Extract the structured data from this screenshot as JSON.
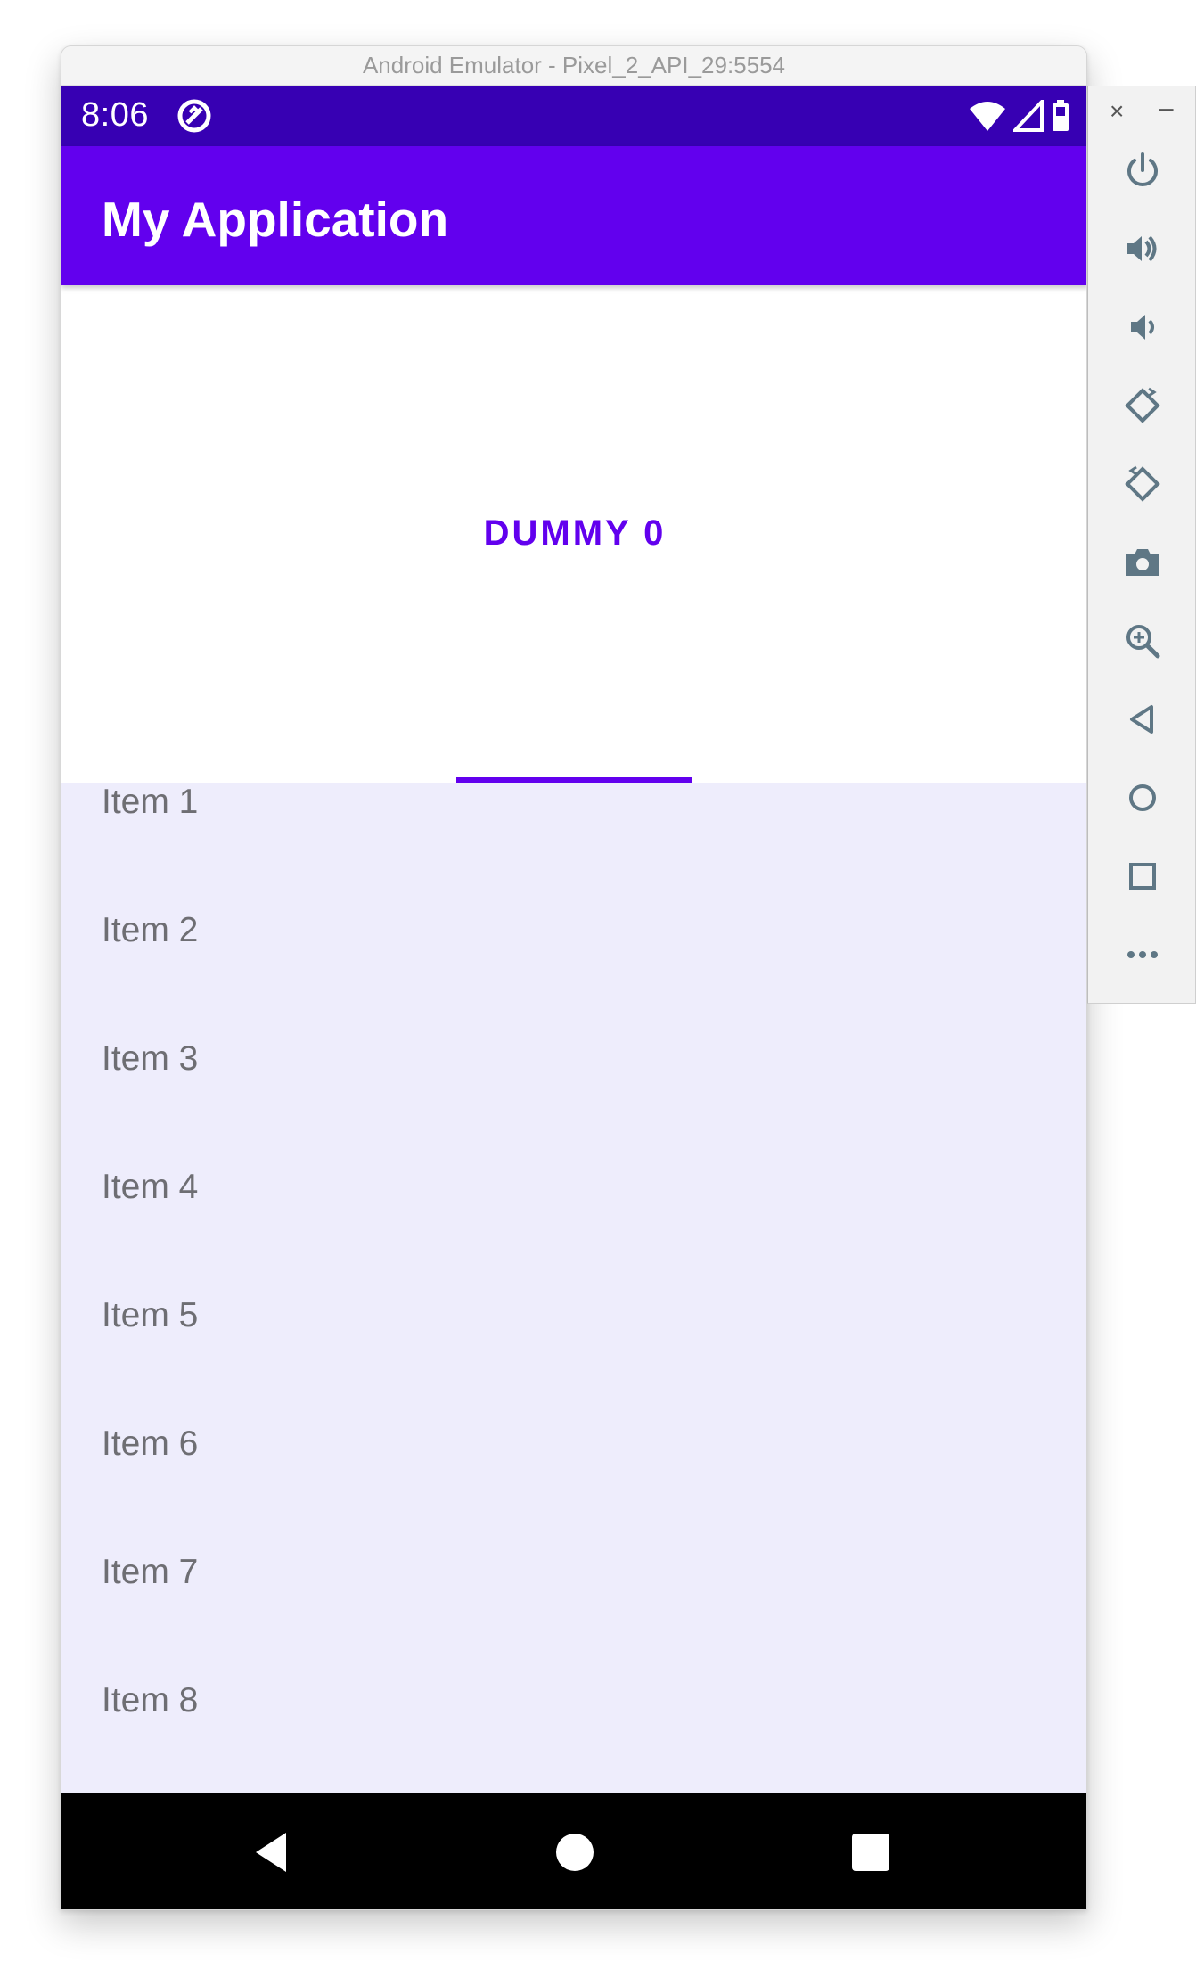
{
  "window": {
    "title": "Android Emulator - Pixel_2_API_29:5554"
  },
  "status_bar": {
    "time": "8:06"
  },
  "app_bar": {
    "title": "My Application"
  },
  "tab": {
    "label": "DUMMY 0"
  },
  "list": {
    "items": [
      {
        "label": "Item 1"
      },
      {
        "label": "Item 2"
      },
      {
        "label": "Item 3"
      },
      {
        "label": "Item 4"
      },
      {
        "label": "Item 5"
      },
      {
        "label": "Item 6"
      },
      {
        "label": "Item 7"
      },
      {
        "label": "Item 8"
      }
    ]
  },
  "toolbar": {
    "close_label": "×",
    "minimize_label": "–",
    "buttons": [
      {
        "icon": "power-icon"
      },
      {
        "icon": "volume-up-icon"
      },
      {
        "icon": "volume-down-icon"
      },
      {
        "icon": "rotate-left-icon"
      },
      {
        "icon": "rotate-right-icon"
      },
      {
        "icon": "camera-icon"
      },
      {
        "icon": "zoom-icon"
      },
      {
        "icon": "back-icon"
      },
      {
        "icon": "home-icon"
      },
      {
        "icon": "overview-icon"
      },
      {
        "icon": "more-icon"
      }
    ]
  },
  "colors": {
    "status_bar": "#3700b3",
    "app_bar": "#6200ee",
    "accent": "#6200ee",
    "list_background": "#eeedfc",
    "nav_bar": "#000000",
    "toolbar_icon": "#5f7785"
  }
}
